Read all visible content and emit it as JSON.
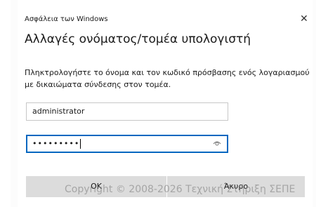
{
  "dialog": {
    "caption": "Ασφάλεια των Windows",
    "close_glyph": "✕",
    "title": "Αλλαγές ονόματος/τομέα υπολογιστή",
    "description": "Πληκτρολογήστε το όνομα και τον κωδικό πρόσβασης ενός λογαριασμού με δικαιώματα σύνδεσης στον τομέα.",
    "username_value": "administrator",
    "password_value": "•••••••••",
    "reveal_icon": "eye-icon",
    "ok_label": "OK",
    "cancel_label": "Άκυρο"
  },
  "watermark": "Copyright © 2008-2026 Τεχνική Στήριξη ΣΕΠΕ",
  "colors": {
    "focus_border": "#0067c0",
    "button_bg": "#dcdcdc"
  }
}
